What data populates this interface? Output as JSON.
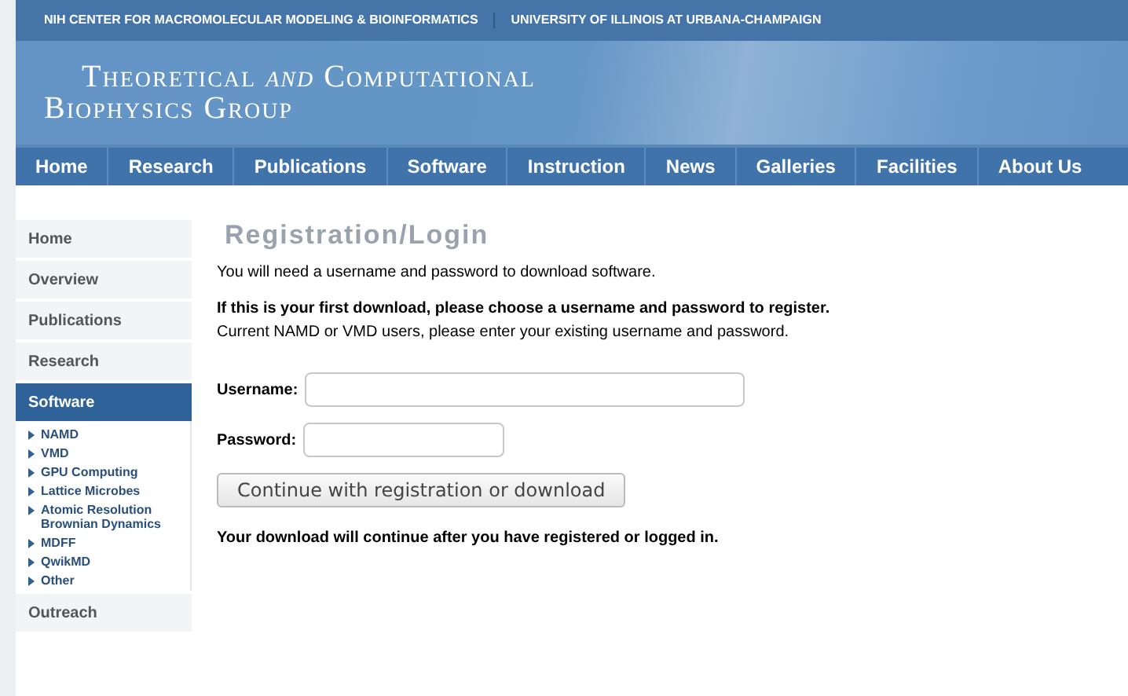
{
  "top_bar": {
    "links": [
      "NIH CENTER FOR MACROMOLECULAR MODELING & BIOINFORMATICS",
      "UNIVERSITY OF ILLINOIS AT URBANA-CHAMPAIGN"
    ]
  },
  "banner": {
    "title_lines": [
      "Theoretical *and* Computational",
      "Biophysics Group"
    ]
  },
  "nav": [
    {
      "label": "Home"
    },
    {
      "label": "Research"
    },
    {
      "label": "Publications"
    },
    {
      "label": "Software"
    },
    {
      "label": "Instruction"
    },
    {
      "label": "News"
    },
    {
      "label": "Galleries"
    },
    {
      "label": "Facilities"
    },
    {
      "label": "About Us"
    }
  ],
  "sidebar": {
    "items": [
      {
        "label": "Home",
        "selected": false
      },
      {
        "label": "Overview",
        "selected": false
      },
      {
        "label": "Publications",
        "selected": false
      },
      {
        "label": "Research",
        "selected": false
      },
      {
        "label": "Software",
        "selected": true,
        "children": [
          "NAMD",
          "VMD",
          "GPU Computing",
          "Lattice Microbes",
          "Atomic Resolution Brownian Dynamics",
          "MDFF",
          "QwikMD",
          "Other"
        ]
      },
      {
        "label": "Outreach",
        "selected": false
      }
    ]
  },
  "content": {
    "heading": "Registration/Login",
    "intro": "You will need a username and password to download software.",
    "first_download": "If this is your first download, please choose a username and password to register.",
    "current_users": "Current NAMD or VMD users, please enter your existing username and password.",
    "fields": [
      {
        "label": "Username:",
        "kind": "text"
      },
      {
        "label": "Password:",
        "kind": "password"
      }
    ],
    "button": "Continue with registration or download",
    "note": "Your download will continue after you have registered or logged in."
  }
}
